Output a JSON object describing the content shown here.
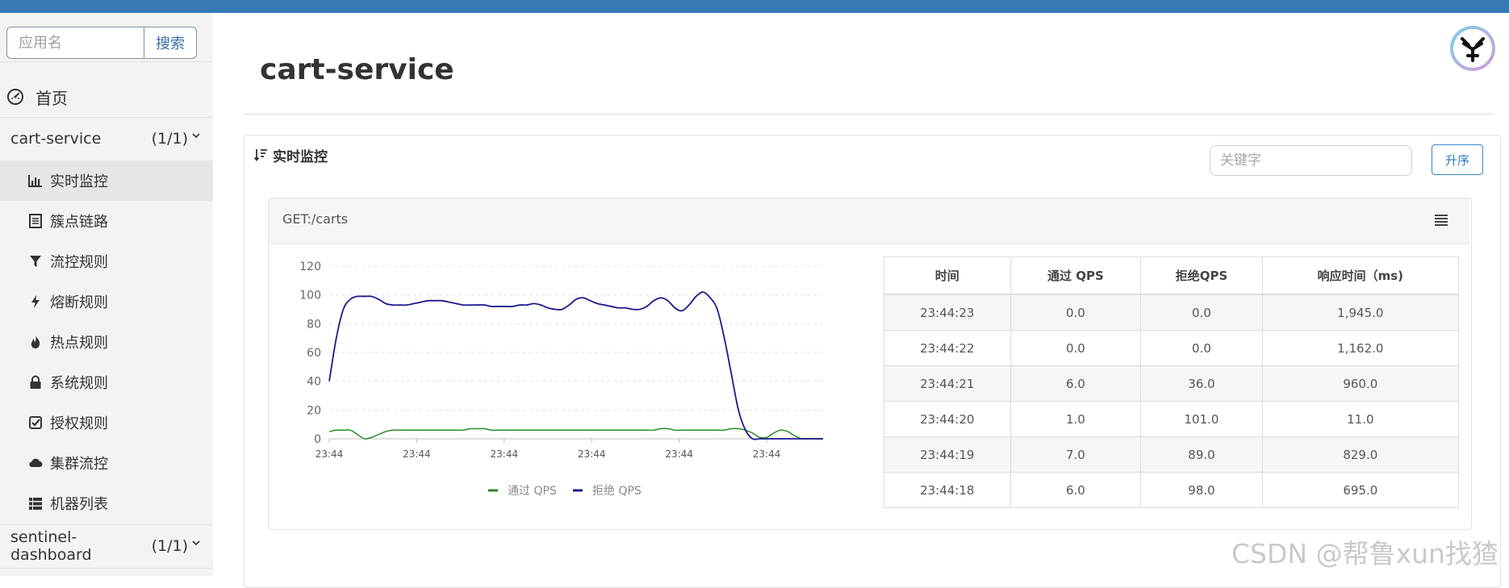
{
  "sidebar": {
    "search_placeholder": "应用名",
    "search_button": "搜索",
    "home_label": "首页",
    "apps": [
      {
        "name": "cart-service",
        "count": "(1/1)"
      },
      {
        "name": "sentinel-dashboard",
        "count": "(1/1)"
      }
    ],
    "menu": [
      {
        "label": "实时监控",
        "icon": "bar-chart-icon",
        "active": true
      },
      {
        "label": "簇点链路",
        "icon": "list-icon"
      },
      {
        "label": "流控规则",
        "icon": "filter-icon"
      },
      {
        "label": "熔断规则",
        "icon": "lightning-icon"
      },
      {
        "label": "热点规则",
        "icon": "fire-icon"
      },
      {
        "label": "系统规则",
        "icon": "lock-icon"
      },
      {
        "label": "授权规则",
        "icon": "check-square-icon"
      },
      {
        "label": "集群流控",
        "icon": "cloud-icon"
      },
      {
        "label": "机器列表",
        "icon": "grid-list-icon"
      }
    ]
  },
  "main": {
    "page_title": "cart-service",
    "panel_title": "实时监控",
    "keyword_placeholder": "关键字",
    "sort_button": "升序",
    "resource_title": "GET:/carts"
  },
  "table": {
    "headers": [
      "时间",
      "通过 QPS",
      "拒绝QPS",
      "响应时间（ms)"
    ],
    "rows": [
      [
        "23:44:23",
        "0.0",
        "0.0",
        "1,945.0"
      ],
      [
        "23:44:22",
        "0.0",
        "0.0",
        "1,162.0"
      ],
      [
        "23:44:21",
        "6.0",
        "36.0",
        "960.0"
      ],
      [
        "23:44:20",
        "1.0",
        "101.0",
        "11.0"
      ],
      [
        "23:44:19",
        "7.0",
        "89.0",
        "829.0"
      ],
      [
        "23:44:18",
        "6.0",
        "98.0",
        "695.0"
      ]
    ]
  },
  "chart_data": {
    "type": "line",
    "x": [
      0,
      1,
      2,
      3,
      4,
      5,
      6,
      7,
      8,
      9,
      10,
      11,
      12,
      13,
      14,
      15,
      16,
      17,
      18,
      19,
      20,
      21,
      22,
      23,
      24,
      25,
      26,
      27,
      28,
      29,
      30,
      31,
      32,
      33,
      34,
      35,
      36,
      37,
      38,
      39,
      40,
      41,
      42,
      43,
      44,
      45,
      46,
      47,
      48,
      49,
      50,
      51,
      52,
      53,
      54,
      55,
      56,
      57,
      58,
      59,
      60,
      61,
      62,
      63,
      64,
      65,
      66,
      67,
      68,
      69,
      70
    ],
    "x_tick_labels": [
      "23:44",
      "23:44",
      "23:44",
      "23:44",
      "23:44",
      "23:44"
    ],
    "x_tick_positions": [
      0,
      12.4,
      24.8,
      37.2,
      49.6,
      62
    ],
    "ylim": [
      0,
      120
    ],
    "y_ticks": [
      0,
      20,
      40,
      60,
      80,
      100,
      120
    ],
    "grid": true,
    "legend_position": "bottom",
    "series": [
      {
        "name": "通过 QPS",
        "color": "#2a8a2a",
        "values": [
          5,
          6,
          6,
          6,
          3,
          0,
          1,
          3,
          5,
          6,
          6,
          6,
          6,
          6,
          6,
          6,
          6,
          6,
          6,
          6,
          7,
          7,
          7,
          6,
          6,
          6,
          6,
          6,
          6,
          6,
          6,
          6,
          6,
          6,
          6,
          6,
          6,
          6,
          6,
          6,
          6,
          6,
          6,
          6,
          6,
          6,
          6,
          7,
          7,
          6,
          6,
          6,
          6,
          6,
          6,
          6,
          6,
          7,
          7,
          6,
          4,
          1,
          1,
          4,
          6,
          5,
          2,
          0,
          0,
          0,
          0
        ]
      },
      {
        "name": "拒绝 QPS",
        "color": "#1a1a8c",
        "values": [
          40,
          70,
          90,
          97,
          99,
          99,
          99,
          97,
          94,
          93,
          93,
          93,
          94,
          95,
          96,
          96,
          96,
          95,
          94,
          93,
          93,
          93,
          93,
          92,
          92,
          92,
          92,
          93,
          93,
          94,
          93,
          91,
          90,
          90,
          93,
          97,
          98,
          96,
          94,
          93,
          92,
          91,
          91,
          90,
          90,
          92,
          96,
          98,
          96,
          91,
          89,
          93,
          99,
          102,
          98,
          90,
          70,
          45,
          20,
          6,
          0,
          0,
          0,
          0,
          0,
          0,
          0,
          0,
          0,
          0,
          0
        ]
      }
    ]
  },
  "watermark": "CSDN @帮鲁xun找猹"
}
